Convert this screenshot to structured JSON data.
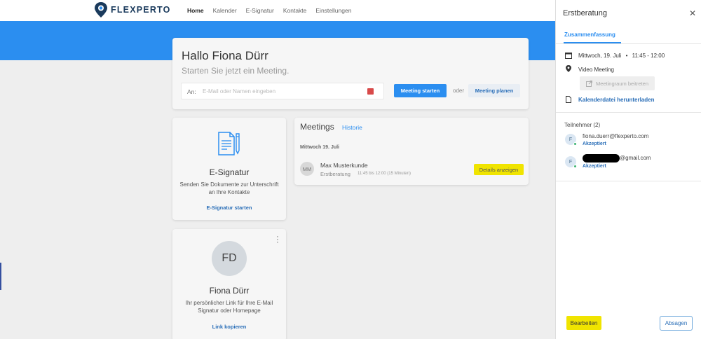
{
  "app": {
    "brand": "FLEXPERTO"
  },
  "nav": {
    "items": [
      "Home",
      "Kalender",
      "E-Signatur",
      "Kontakte",
      "Einstellungen"
    ]
  },
  "greeting": {
    "title": "Hallo Fiona Dürr",
    "subtitle": "Starten Sie jetzt ein Meeting.",
    "invite_label": "An:",
    "invite_placeholder": "E-Mail oder Namen eingeben",
    "start_button": "Meeting starten",
    "or_text": "oder",
    "plan_button": "Meeting planen"
  },
  "esignature": {
    "title": "E-Signatur",
    "description": "Senden Sie Dokumente zur Unterschrift an Ihre Kontakte",
    "link": "E-Signatur starten"
  },
  "meetings": {
    "title": "Meetings",
    "history_link": "Historie",
    "date_header": "Mittwoch 19. Juli",
    "item": {
      "initials": "MM",
      "name": "Max Musterkunde",
      "type": "Erstberatung",
      "time": "11:45 bis 12:00 (15 Minuten)",
      "details_button": "Details anzeigen"
    }
  },
  "profile": {
    "initials": "FD",
    "name": "Fiona Dürr",
    "description": "Ihr persönlicher Link für Ihre E-Mail Signatur oder Homepage",
    "link": "Link kopieren"
  },
  "panel": {
    "title": "Erstberatung",
    "tab": "Zusammenfassung",
    "date": "Mittwoch, 19. Juli",
    "separator": "•",
    "time": "11:45 - 12:00",
    "location": "Video Meeting",
    "join_button": "Meetingraum beitreten",
    "download_link": "Kalenderdatei herunterladen",
    "participants_title": "Teilnehmer (2)",
    "participants": [
      {
        "initial": "F",
        "email": "fiona.duerr@flexperto.com",
        "status": "Akzeptiert"
      },
      {
        "initial": "F",
        "email": "@gmail.com",
        "status": "Akzeptiert"
      }
    ],
    "edit_button": "Bearbeiten",
    "cancel_button": "Absagen"
  },
  "colors": {
    "accent": "#2b8ef0",
    "highlight": "#f0e400",
    "link": "#2b6fb8"
  }
}
